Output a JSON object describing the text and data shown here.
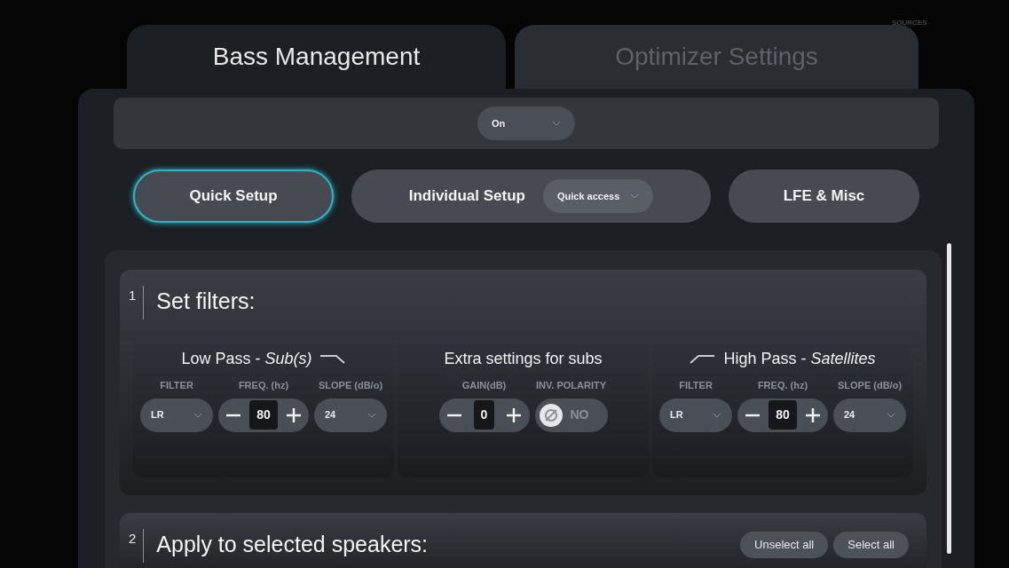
{
  "tabs": [
    {
      "label": "Bass Management",
      "selected": true
    },
    {
      "label": "Optimizer Settings",
      "selected": false
    }
  ],
  "sources_label": "SOURCES",
  "mode_select": {
    "value": "On"
  },
  "setup_buttons": [
    {
      "kind": "button",
      "label": "Quick Setup",
      "selected": true
    },
    {
      "kind": "button_with_select",
      "label": "Individual Setup",
      "select_value": "Quick access",
      "selected": false
    },
    {
      "kind": "button",
      "label": "LFE & Misc",
      "selected": false
    }
  ],
  "sections": [
    {
      "number": "1",
      "title": "Set filters:",
      "groups": [
        {
          "title": "Low Pass - *Sub(s)*",
          "kind": "lowpass",
          "controls": [
            {
              "kind": "select",
              "label": "FILTER",
              "value": "LR"
            },
            {
              "kind": "stepper",
              "label": "FREQ. (hz)",
              "value": "80"
            },
            {
              "kind": "select",
              "label": "SLOPE (dB/o)",
              "value": "24"
            }
          ]
        },
        {
          "title": "Extra settings for subs",
          "kind": "plain",
          "controls": [
            {
              "kind": "stepper",
              "label": "GAIN(dB)",
              "value": "0"
            },
            {
              "kind": "toggle",
              "label": "INV. POLARITY",
              "value": "NO",
              "on": false
            }
          ]
        },
        {
          "title": "High Pass - *Satellites*",
          "kind": "highpass",
          "controls": [
            {
              "kind": "select",
              "label": "FILTER",
              "value": "LR"
            },
            {
              "kind": "stepper",
              "label": "FREQ. (hz)",
              "value": "80"
            },
            {
              "kind": "select",
              "label": "SLOPE (dB/o)",
              "value": "24"
            }
          ]
        }
      ]
    },
    {
      "number": "2",
      "title": "Apply to selected speakers:",
      "actions": [
        "Unselect all",
        "Select all"
      ]
    }
  ]
}
